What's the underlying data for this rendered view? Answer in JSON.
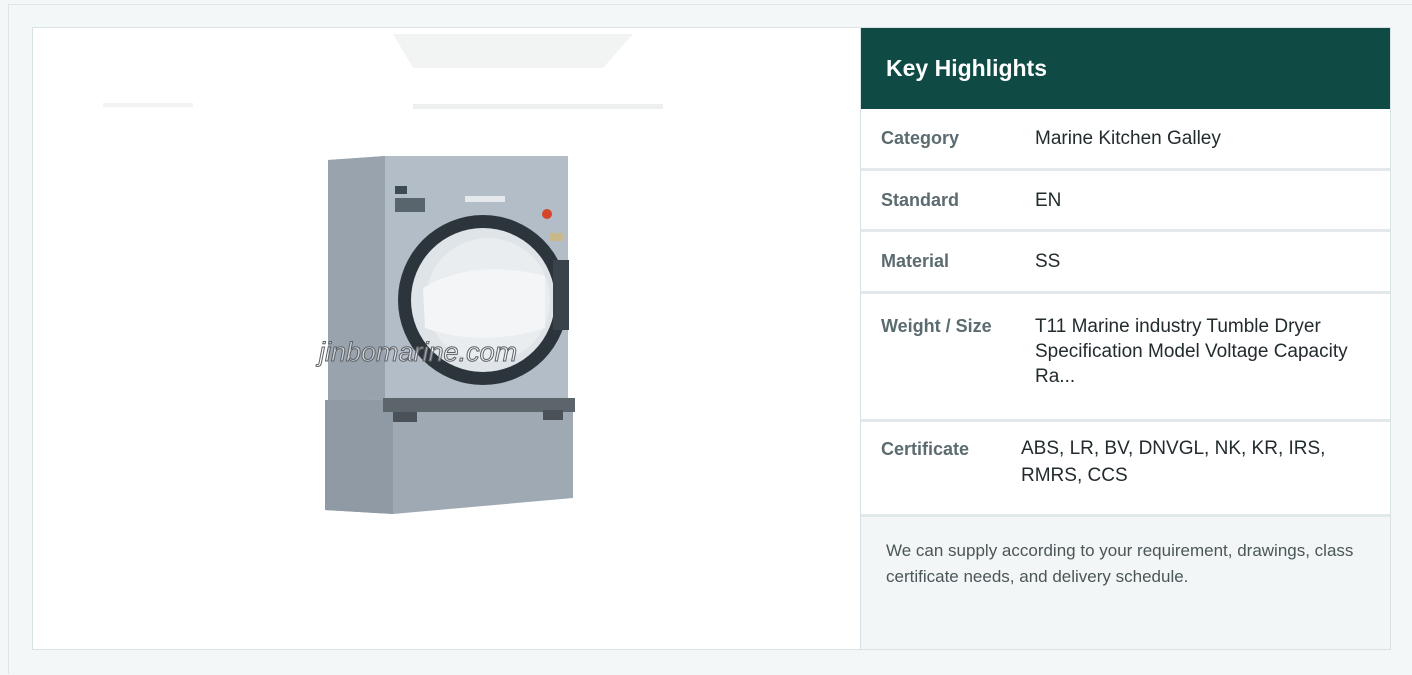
{
  "image": {
    "alt": "Tumble dryer product photo",
    "watermark": "jinbomarine.com"
  },
  "highlights": {
    "title": "Key Highlights",
    "rows": [
      {
        "label": "Category",
        "value": "Marine Kitchen Galley"
      },
      {
        "label": "Standard",
        "value": "EN"
      },
      {
        "label": "Material",
        "value": "SS"
      },
      {
        "label": "Weight / Size",
        "value": "T11 Marine industry Tumble Dryer Specification Model Voltage Capacity Ra..."
      },
      {
        "label": "Certificate",
        "value": "ABS, LR, BV, DNVGL, NK, KR, IRS, RMRS, CCS"
      }
    ],
    "note": "We can supply according to your requirement, drawings, class certificate needs, and delivery schedule."
  },
  "colors": {
    "header_bg": "#0f4a45",
    "page_bg": "#f4f7f8",
    "label_text": "#5b6b70"
  }
}
